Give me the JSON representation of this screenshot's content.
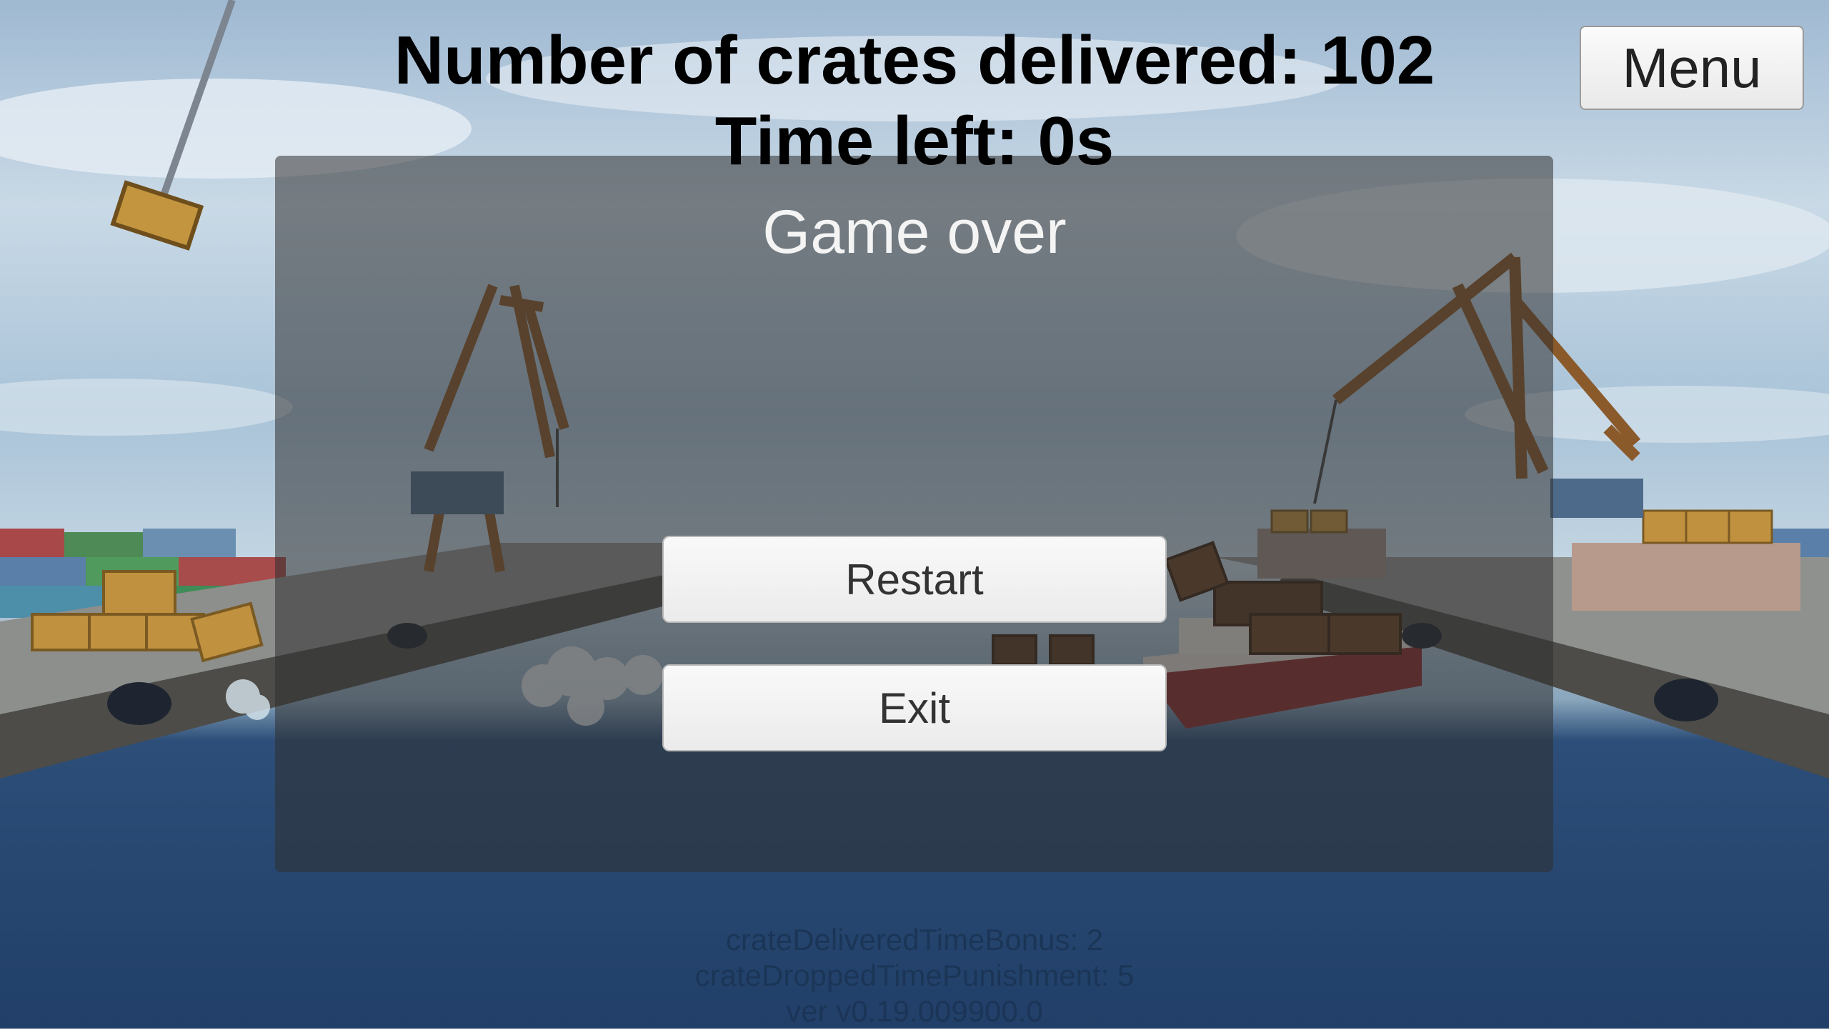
{
  "hud": {
    "crates_label": "Number of crates delivered: 102",
    "time_label": "Time left: 0s"
  },
  "menu_button": {
    "label": "Menu"
  },
  "game_over_panel": {
    "title": "Game over",
    "restart_label": "Restart",
    "exit_label": "Exit"
  },
  "debug": {
    "line1": "crateDeliveredTimeBonus: 2",
    "line2": "crateDroppedTimePunishment: 5",
    "line3": "ver v0.19.009900.0"
  },
  "colors": {
    "panel_overlay": "#303030",
    "water": "#213f68",
    "sky": "#c9d9e6",
    "crane": "#8a5a2b",
    "crate": "#b8893e"
  }
}
